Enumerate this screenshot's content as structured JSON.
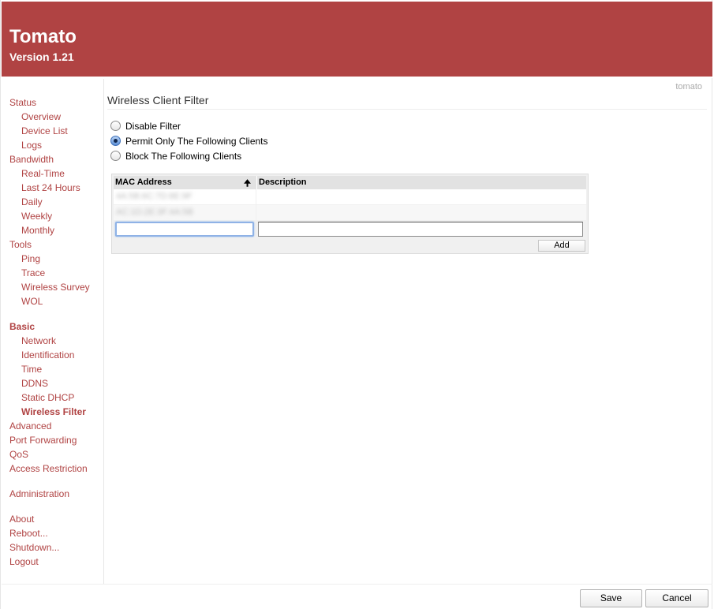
{
  "header": {
    "title": "Tomato",
    "version": "Version 1.21"
  },
  "host": "tomato",
  "nav": {
    "status": "Status",
    "overview": "Overview",
    "device_list": "Device List",
    "logs": "Logs",
    "bandwidth": "Bandwidth",
    "real_time": "Real-Time",
    "last_24": "Last 24 Hours",
    "daily": "Daily",
    "weekly": "Weekly",
    "monthly": "Monthly",
    "tools": "Tools",
    "ping": "Ping",
    "trace": "Trace",
    "wireless_survey": "Wireless Survey",
    "wol": "WOL",
    "basic": "Basic",
    "network": "Network",
    "identification": "Identification",
    "time": "Time",
    "ddns": "DDNS",
    "static_dhcp": "Static DHCP",
    "wireless_filter": "Wireless Filter",
    "advanced": "Advanced",
    "port_forwarding": "Port Forwarding",
    "qos": "QoS",
    "access_restriction": "Access Restriction",
    "administration": "Administration",
    "about": "About",
    "reboot": "Reboot...",
    "shutdown": "Shutdown...",
    "logout": "Logout"
  },
  "page": {
    "title": "Wireless Client Filter",
    "options": [
      "Disable Filter",
      "Permit Only The Following Clients",
      "Block The Following Clients"
    ],
    "selected_option": "Permit Only The Following Clients"
  },
  "grid": {
    "columns": [
      "MAC Address",
      "Description"
    ],
    "sort_icon": "arrow-up-icon",
    "rows": [
      {
        "mac": "4A:5B:6C:7D:8E:9F",
        "description": ""
      },
      {
        "mac": "AC:1D:2E:3F:4A:5B",
        "description": ""
      }
    ],
    "new_mac": "",
    "new_description": "",
    "add_label": "Add"
  },
  "footer": {
    "save_label": "Save",
    "cancel_label": "Cancel"
  },
  "colors": {
    "accent": "#b04343"
  }
}
